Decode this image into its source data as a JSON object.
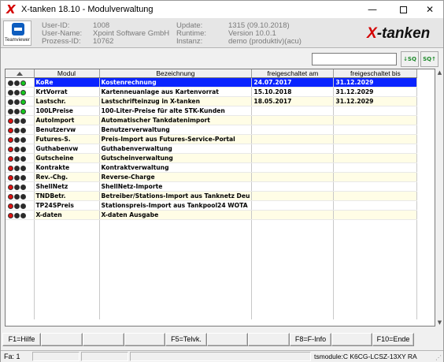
{
  "window": {
    "title": "X-tanken 18.10  -  Modulverwaltung",
    "min_symbol": "—",
    "close_symbol": "✕"
  },
  "header": {
    "teamviewer_label": "Teamviewer",
    "user_id_label": "User-ID:",
    "user_id": "1008",
    "user_name_label": "User-Name:",
    "user_name": "Xpoint Software GmbH",
    "process_id_label": "Prozess-ID:",
    "process_id": "10762",
    "update_label": "Update:",
    "update": "1315 (09.10.2018)",
    "runtime_label": "Runtime:",
    "runtime": "Version 10.0.1",
    "instance_label": "Instanz:",
    "instance": "demo (produktiv)(acu)",
    "brand_x": "X",
    "brand_rest": "-tanken"
  },
  "toolbar": {
    "search_value": "",
    "btn1_label": "↓SQ",
    "btn2_label": "SQ↑"
  },
  "table": {
    "columns": [
      "Modul",
      "Bezeichnung",
      "freigeschaltet am",
      "freigeschaltet bis"
    ],
    "rows": [
      {
        "status": "green",
        "modul": "KoRe",
        "bezeichnung": "Kostenrechnung",
        "am": "24.07.2017",
        "bis": "31.12.2029"
      },
      {
        "status": "green",
        "modul": "KrtVorrat",
        "bezeichnung": "Kartenneuanlage aus Kartenvorrat",
        "am": "15.10.2018",
        "bis": "31.12.2029"
      },
      {
        "status": "green",
        "modul": "Lastschr.",
        "bezeichnung": "Lastschrifteinzug in X-tanken",
        "am": "18.05.2017",
        "bis": "31.12.2029"
      },
      {
        "status": "green",
        "modul": "100LPreise",
        "bezeichnung": "100-Liter-Preise für alte STK-Kunden",
        "am": "",
        "bis": ""
      },
      {
        "status": "red",
        "modul": "AutoImport",
        "bezeichnung": "Automatischer Tankdatenimport",
        "am": "",
        "bis": ""
      },
      {
        "status": "red",
        "modul": "Benutzervw",
        "bezeichnung": "Benutzerverwaltung",
        "am": "",
        "bis": ""
      },
      {
        "status": "red",
        "modul": "Futures-S.",
        "bezeichnung": "Preis-Import aus Futures-Service-Portal",
        "am": "",
        "bis": ""
      },
      {
        "status": "red",
        "modul": "Guthabenvw",
        "bezeichnung": "Guthabenverwaltung",
        "am": "",
        "bis": ""
      },
      {
        "status": "red",
        "modul": "Gutscheine",
        "bezeichnung": "Gutscheinverwaltung",
        "am": "",
        "bis": ""
      },
      {
        "status": "red",
        "modul": "Kontrakte",
        "bezeichnung": "Kontraktverwaltung",
        "am": "",
        "bis": ""
      },
      {
        "status": "red",
        "modul": "Rev.-Chg.",
        "bezeichnung": "Reverse-Charge",
        "am": "",
        "bis": ""
      },
      {
        "status": "red",
        "modul": "ShellNetz",
        "bezeichnung": "ShellNetz-Importe",
        "am": "",
        "bis": ""
      },
      {
        "status": "red",
        "modul": "TNDBetr.",
        "bezeichnung": "Betreiber/Stations-Import aus Tanknetz Deu",
        "am": "",
        "bis": ""
      },
      {
        "status": "red",
        "modul": "TP24SPreis",
        "bezeichnung": "Stationspreis-Import aus Tankpool24 WOTA",
        "am": "",
        "bis": ""
      },
      {
        "status": "red",
        "modul": "X-daten",
        "bezeichnung": "X-daten Ausgabe",
        "am": "",
        "bis": ""
      }
    ]
  },
  "fkeys": {
    "f1": "F1=Hilfe",
    "f5": "F5=Telvk.",
    "f8": "F8=F-Info",
    "f10": "F10=Ende"
  },
  "status": {
    "left": "Fa: 1",
    "right": "tsmodule:C K6CG-LCSZ-13XY RA"
  },
  "colors": {
    "selection": "#0a24ff",
    "odd_row": "#fffde6",
    "brand_red": "#d40000"
  }
}
